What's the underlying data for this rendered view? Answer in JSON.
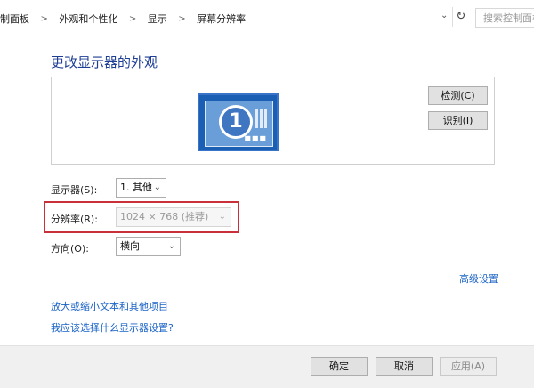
{
  "address_bar": {
    "breadcrumbs": [
      "制面板",
      "外观和个性化",
      "显示",
      "屏幕分辨率"
    ],
    "search_placeholder": "搜索控制面板"
  },
  "page": {
    "title": "更改显示器的外观",
    "detect_button": "检测(C)",
    "identify_button": "识别(I)",
    "monitor_number": "1",
    "display_label": "显示器(S):",
    "display_value": "1. 其他",
    "resolution_label": "分辨率(R):",
    "resolution_value": "1024 × 768 (推荐)",
    "orientation_label": "方向(O):",
    "orientation_value": "横向",
    "advanced_link": "高级设置",
    "link_text_size": "放大或缩小文本和其他项目",
    "link_which_settings": "我应该选择什么显示器设置?"
  },
  "footer": {
    "ok": "确定",
    "cancel": "取消",
    "apply": "应用(A)"
  },
  "colors": {
    "highlight": "#c9303a",
    "link": "#1b63c6",
    "heading": "#1e3e95"
  }
}
